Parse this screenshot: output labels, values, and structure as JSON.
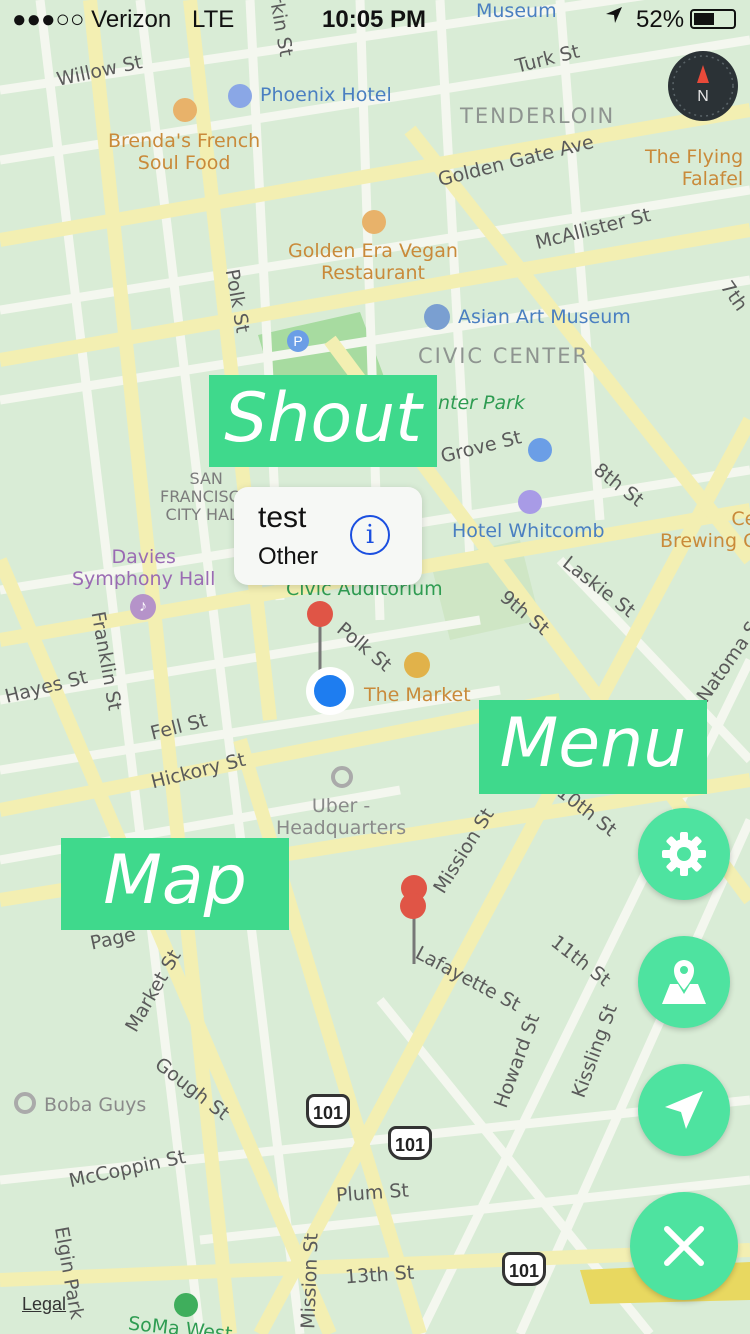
{
  "status_bar": {
    "carrier": "●●●○○ Verizon",
    "network": "LTE",
    "time": "10:05 PM",
    "battery": "52%"
  },
  "map": {
    "streets": {
      "willow": "Willow St",
      "turk": "Turk St",
      "golden_gate": "Golden Gate Ave",
      "mcallister": "McAllister St",
      "polk1": "Polk St",
      "polk2": "Polk St",
      "larkin": "rkin St",
      "grove": "Grove St",
      "eighth": "8th St",
      "laskie": "Laskie St",
      "ninth": "9th St",
      "natoma": "Natoma St",
      "hayes": "Hayes St",
      "franklin": "Franklin St",
      "fell": "Fell St",
      "hickory": "Hickory St",
      "tenth": "10th St",
      "mission1": "Mission St",
      "eleventh": "11th St",
      "lafayette": "Lafayette St",
      "market": "Market St",
      "howard": "Howard St",
      "kissling": "Kissling St",
      "gough": "Gough St",
      "mccoppin": "McCoppin St",
      "plum": "Plum St",
      "thirteenth": "13th St",
      "mission2": "Mission St",
      "elgin": "Elgin Park",
      "page": "Page",
      "seventh": "7th"
    },
    "pois": {
      "museum": "Museum",
      "phoenix": "Phoenix Hotel",
      "tenderloin": "TENDERLOIN",
      "brendas": "Brenda's French\nSoul Food",
      "flying_falafel": "The Flying\nFalafel",
      "golden_era": "Golden Era Vegan\nRestaurant",
      "asian_art": "Asian Art Museum",
      "civic_center": "CIVIC CENTER",
      "center_park": "nter Park",
      "city_hall": "SAN\nFRANCISCO\nCITY HALL",
      "hotel_whitcomb": "Hotel Whitcomb",
      "brewing": "Ce\nBrewing C",
      "davies": "Davies\nSymphony Hall",
      "auditorium": "Civic Auditorium",
      "the_market": "The Market",
      "uber": "Uber -\nHeadquarters",
      "boba": "Boba Guys",
      "soma": "SoMa West",
      "highway": "101"
    },
    "legal": "Legal"
  },
  "callout": {
    "title": "test",
    "subtitle": "Other",
    "info_glyph": "i"
  },
  "labels": {
    "shout": "Shout",
    "menu": "Menu",
    "map": "Map"
  },
  "compass_letter": "N",
  "colors": {
    "map_bg": "#d9ecd6",
    "road_yellow": "#f3efb2",
    "road_white": "#f4f7ef",
    "park": "#a7dba0",
    "fab": "#4ee3a0",
    "overlay": "#3fd98c",
    "pin": "#e05546",
    "user_dot": "#1e7df0"
  },
  "icons": [
    "settings-gear-icon",
    "map-pin-icon",
    "navigation-arrow-icon",
    "close-icon",
    "compass-icon",
    "location-arrow-icon",
    "info-icon"
  ]
}
